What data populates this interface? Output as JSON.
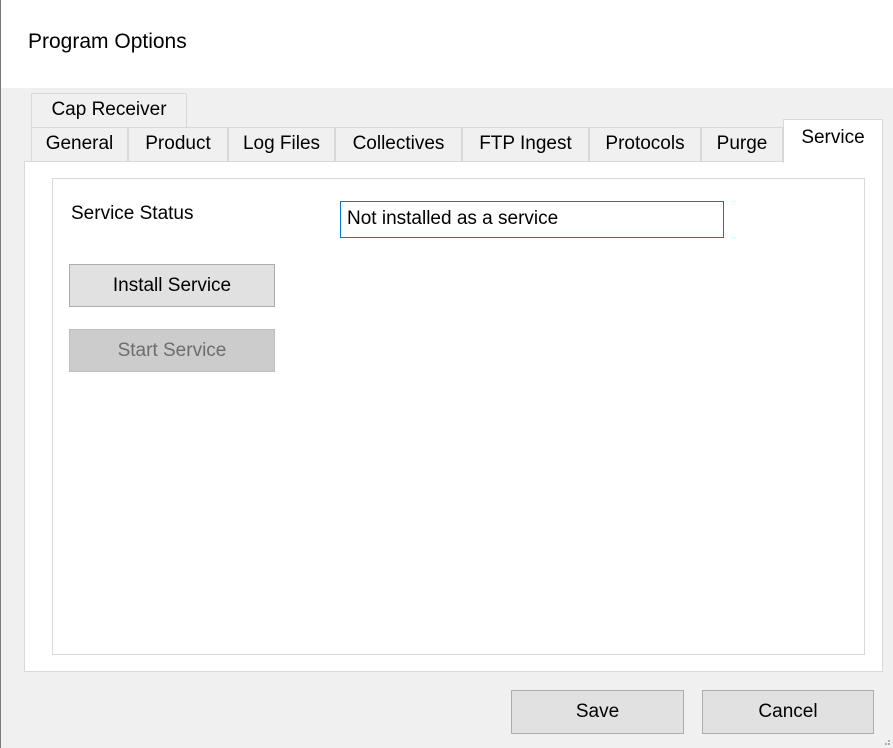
{
  "window": {
    "title": "Program Options"
  },
  "tabs": {
    "row1": [
      {
        "label": "Cap Receiver"
      }
    ],
    "row2": [
      {
        "label": "General"
      },
      {
        "label": "Product"
      },
      {
        "label": "Log Files"
      },
      {
        "label": "Collectives"
      },
      {
        "label": "FTP Ingest"
      },
      {
        "label": "Protocols"
      },
      {
        "label": "Purge"
      },
      {
        "label": "Service"
      }
    ],
    "selected": "Service"
  },
  "service": {
    "status_label": "Service Status",
    "status_value": "Not installed as a service",
    "install_button": "Install Service",
    "start_button": "Start Service"
  },
  "footer": {
    "save_label": "Save",
    "cancel_label": "Cancel"
  }
}
